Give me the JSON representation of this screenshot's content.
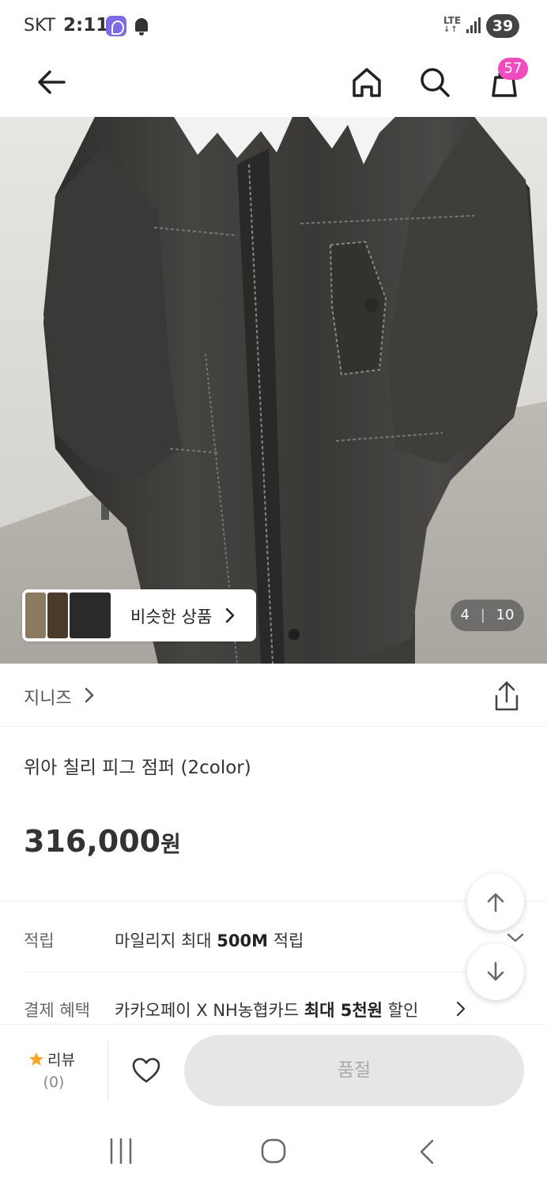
{
  "status_bar": {
    "carrier": "SKT",
    "time": "2:11",
    "network": "LTE",
    "battery": "39",
    "icons": [
      "app-icon",
      "bell-icon",
      "signal-icon",
      "battery-icon"
    ]
  },
  "header": {
    "icons": [
      "back-arrow-icon",
      "home-icon",
      "search-icon",
      "cart-icon"
    ],
    "cart_count": "57"
  },
  "gallery": {
    "similar_label": "비슷한 상품",
    "current_page": "4",
    "page_separator": "|",
    "total_pages": "10"
  },
  "brand": {
    "name": "지니즈"
  },
  "product": {
    "title": "위아 칠리 피그 점퍼 (2color)",
    "price": "316,000",
    "price_unit": "원"
  },
  "info_rows": [
    {
      "label": "적립",
      "value_prefix": "마일리지 최대 ",
      "value_bold": "500M",
      "value_suffix": " 적립"
    },
    {
      "label": "결제 혜택",
      "value_prefix": "카카오페이 X NH농협카드 ",
      "value_bold": "최대 5천원",
      "value_suffix": " 할인"
    }
  ],
  "bottom_bar": {
    "review_label": "리뷰",
    "review_count": "(0)",
    "soldout_label": "품절"
  },
  "colors": {
    "cart_badge": "#f04bbf",
    "star": "#f5a623",
    "soldout_bg": "#e6e6e6",
    "soldout_text": "#aaaaaa"
  }
}
